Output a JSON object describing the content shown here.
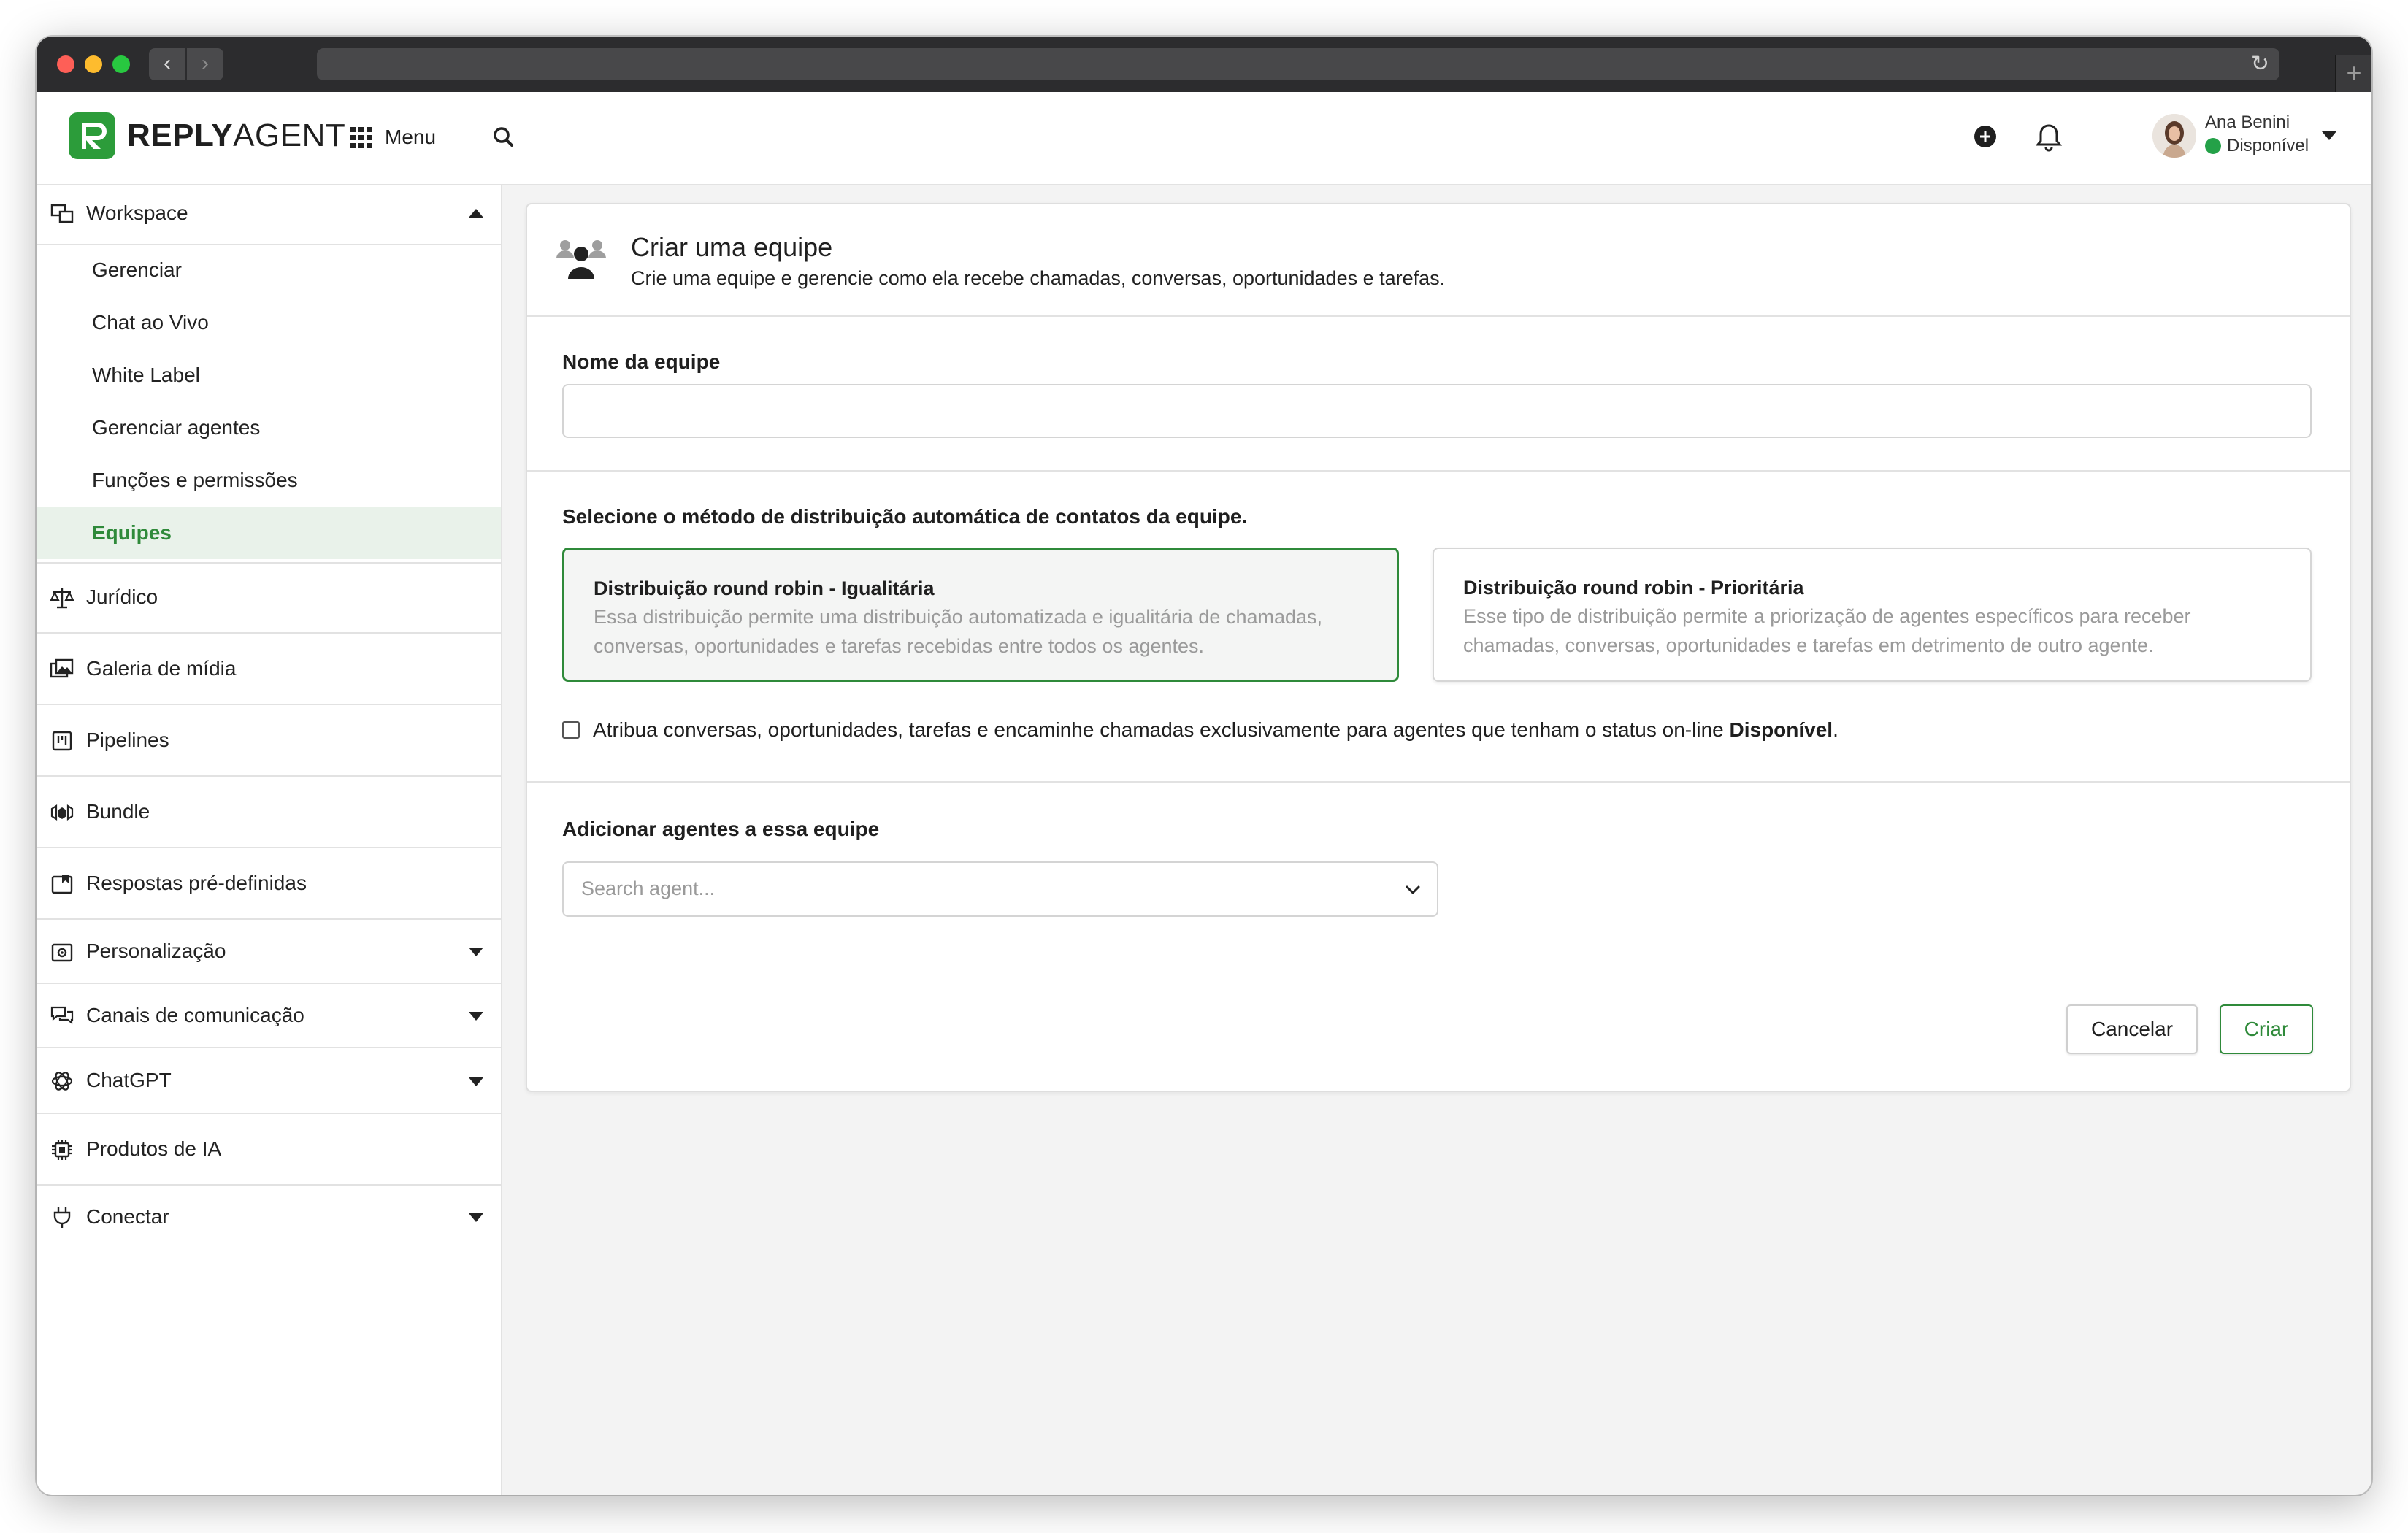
{
  "brand": {
    "name_bold": "REPLY",
    "name_light": "AGENT",
    "accent_color": "#2c9c3a"
  },
  "header": {
    "menu_label": "Menu",
    "user": {
      "name": "Ana Benini",
      "status": "Disponível",
      "status_color": "#24a148"
    }
  },
  "sidebar": {
    "workspace": {
      "label": "Workspace",
      "items": [
        {
          "label": "Gerenciar"
        },
        {
          "label": "Chat ao Vivo"
        },
        {
          "label": "White Label"
        },
        {
          "label": "Gerenciar agentes"
        },
        {
          "label": "Funções e permissões"
        },
        {
          "label": "Equipes",
          "active": true
        }
      ]
    },
    "sections": [
      {
        "label": "Jurídico",
        "icon": "scale-icon"
      },
      {
        "label": "Galeria de mídia",
        "icon": "images-icon"
      },
      {
        "label": "Pipelines",
        "icon": "kanban-icon"
      },
      {
        "label": "Bundle",
        "icon": "bundle-icon"
      },
      {
        "label": "Respostas pré-definidas",
        "icon": "saved-replies-icon"
      },
      {
        "label": "Personalização",
        "icon": "customize-icon",
        "expandable": true
      },
      {
        "label": "Canais de comunicação",
        "icon": "chat-bubbles-icon",
        "expandable": true
      },
      {
        "label": "ChatGPT",
        "icon": "openai-icon",
        "expandable": true
      },
      {
        "label": "Produtos de IA",
        "icon": "chip-icon"
      },
      {
        "label": "Conectar",
        "icon": "plug-icon",
        "expandable": true
      }
    ]
  },
  "card": {
    "title": "Criar uma equipe",
    "subtitle": "Crie uma equipe e gerencie como ela recebe chamadas, conversas, oportunidades e tarefas.",
    "team_name_label": "Nome da equipe",
    "team_name_value": "",
    "distribution_label": "Selecione o método de distribuição automática de contatos da equipe.",
    "options": [
      {
        "title": "Distribuição round robin - Igualitária",
        "description": "Essa distribuição permite uma distribuição automatizada e igualitária de chamadas, conversas, oportunidades e tarefas recebidas entre todos os agentes.",
        "selected": true
      },
      {
        "title": "Distribuição round robin - Prioritária",
        "description": "Esse tipo de distribuição permite a priorização de agentes específicos para receber chamadas, conversas, oportunidades e tarefas em detrimento de outro agente.",
        "selected": false
      }
    ],
    "checkbox": {
      "text": "Atribua conversas, oportunidades, tarefas e encaminhe chamadas exclusivamente para agentes que tenham o status on-line ",
      "text_bold": "Disponível",
      "text_end": ".",
      "checked": false
    },
    "agents_label": "Adicionar agentes a essa equipe",
    "agents_placeholder": "Search agent...",
    "cancel_label": "Cancelar",
    "create_label": "Criar"
  }
}
